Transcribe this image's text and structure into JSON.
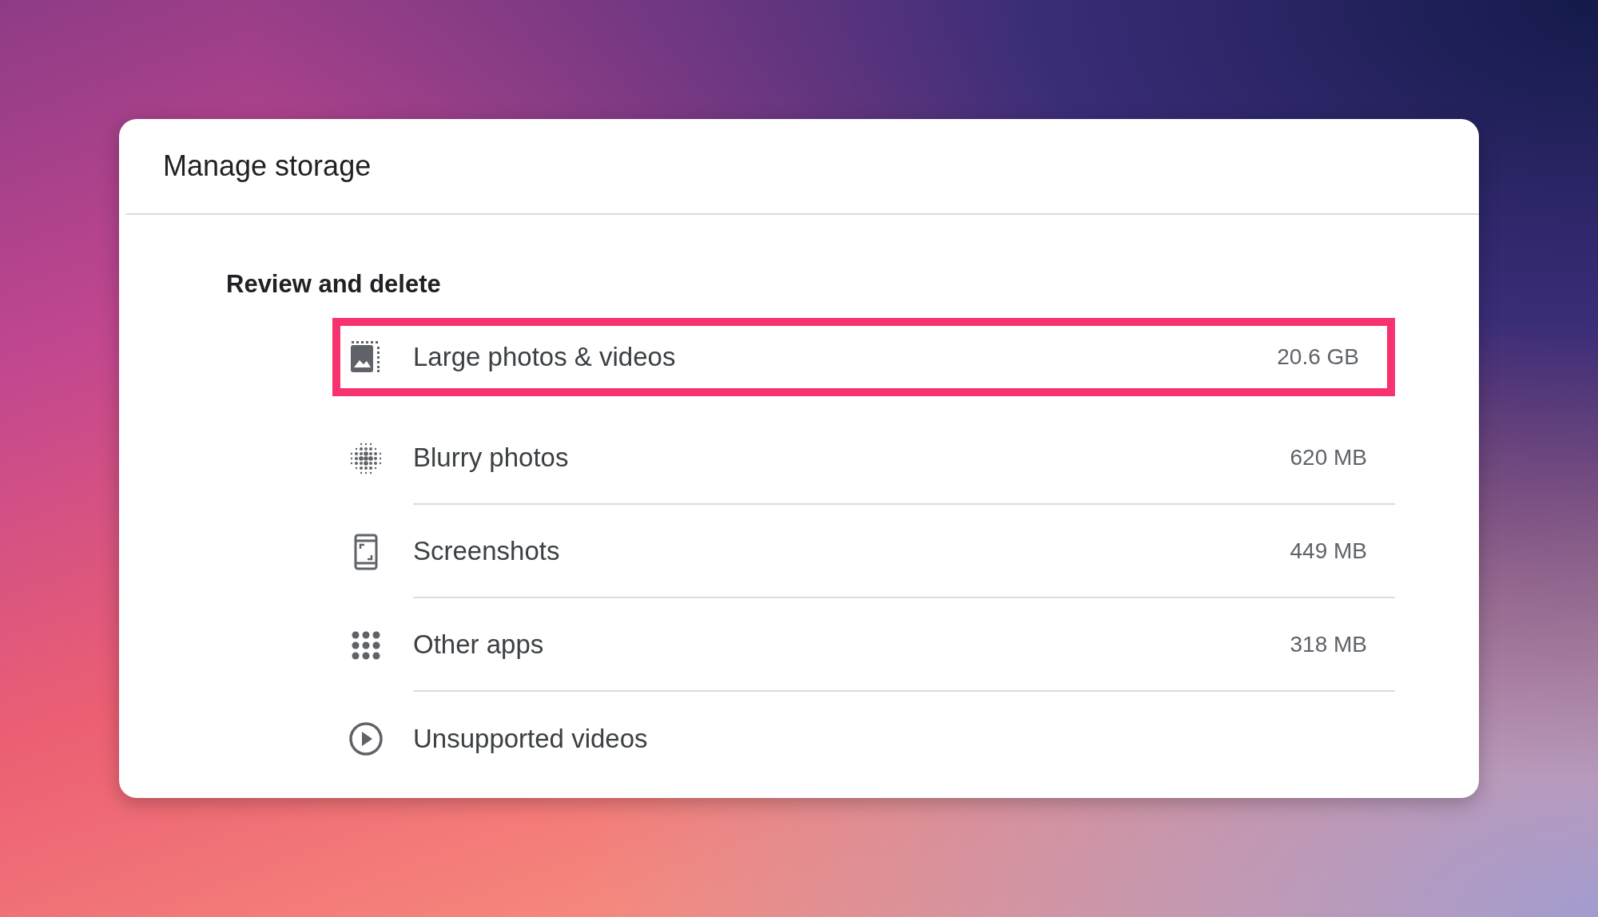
{
  "dialog": {
    "title": "Manage storage"
  },
  "section": {
    "heading": "Review and delete",
    "items": [
      {
        "kind": "large",
        "label": "Large photos & videos",
        "size": "20.6 GB",
        "highlighted": true
      },
      {
        "kind": "blurry",
        "label": "Blurry photos",
        "size": "620 MB",
        "highlighted": false
      },
      {
        "kind": "screenshots",
        "label": "Screenshots",
        "size": "449 MB",
        "highlighted": false
      },
      {
        "kind": "apps",
        "label": "Other apps",
        "size": "318 MB",
        "highlighted": false
      },
      {
        "kind": "video",
        "label": "Unsupported videos",
        "highlighted": false
      }
    ]
  }
}
